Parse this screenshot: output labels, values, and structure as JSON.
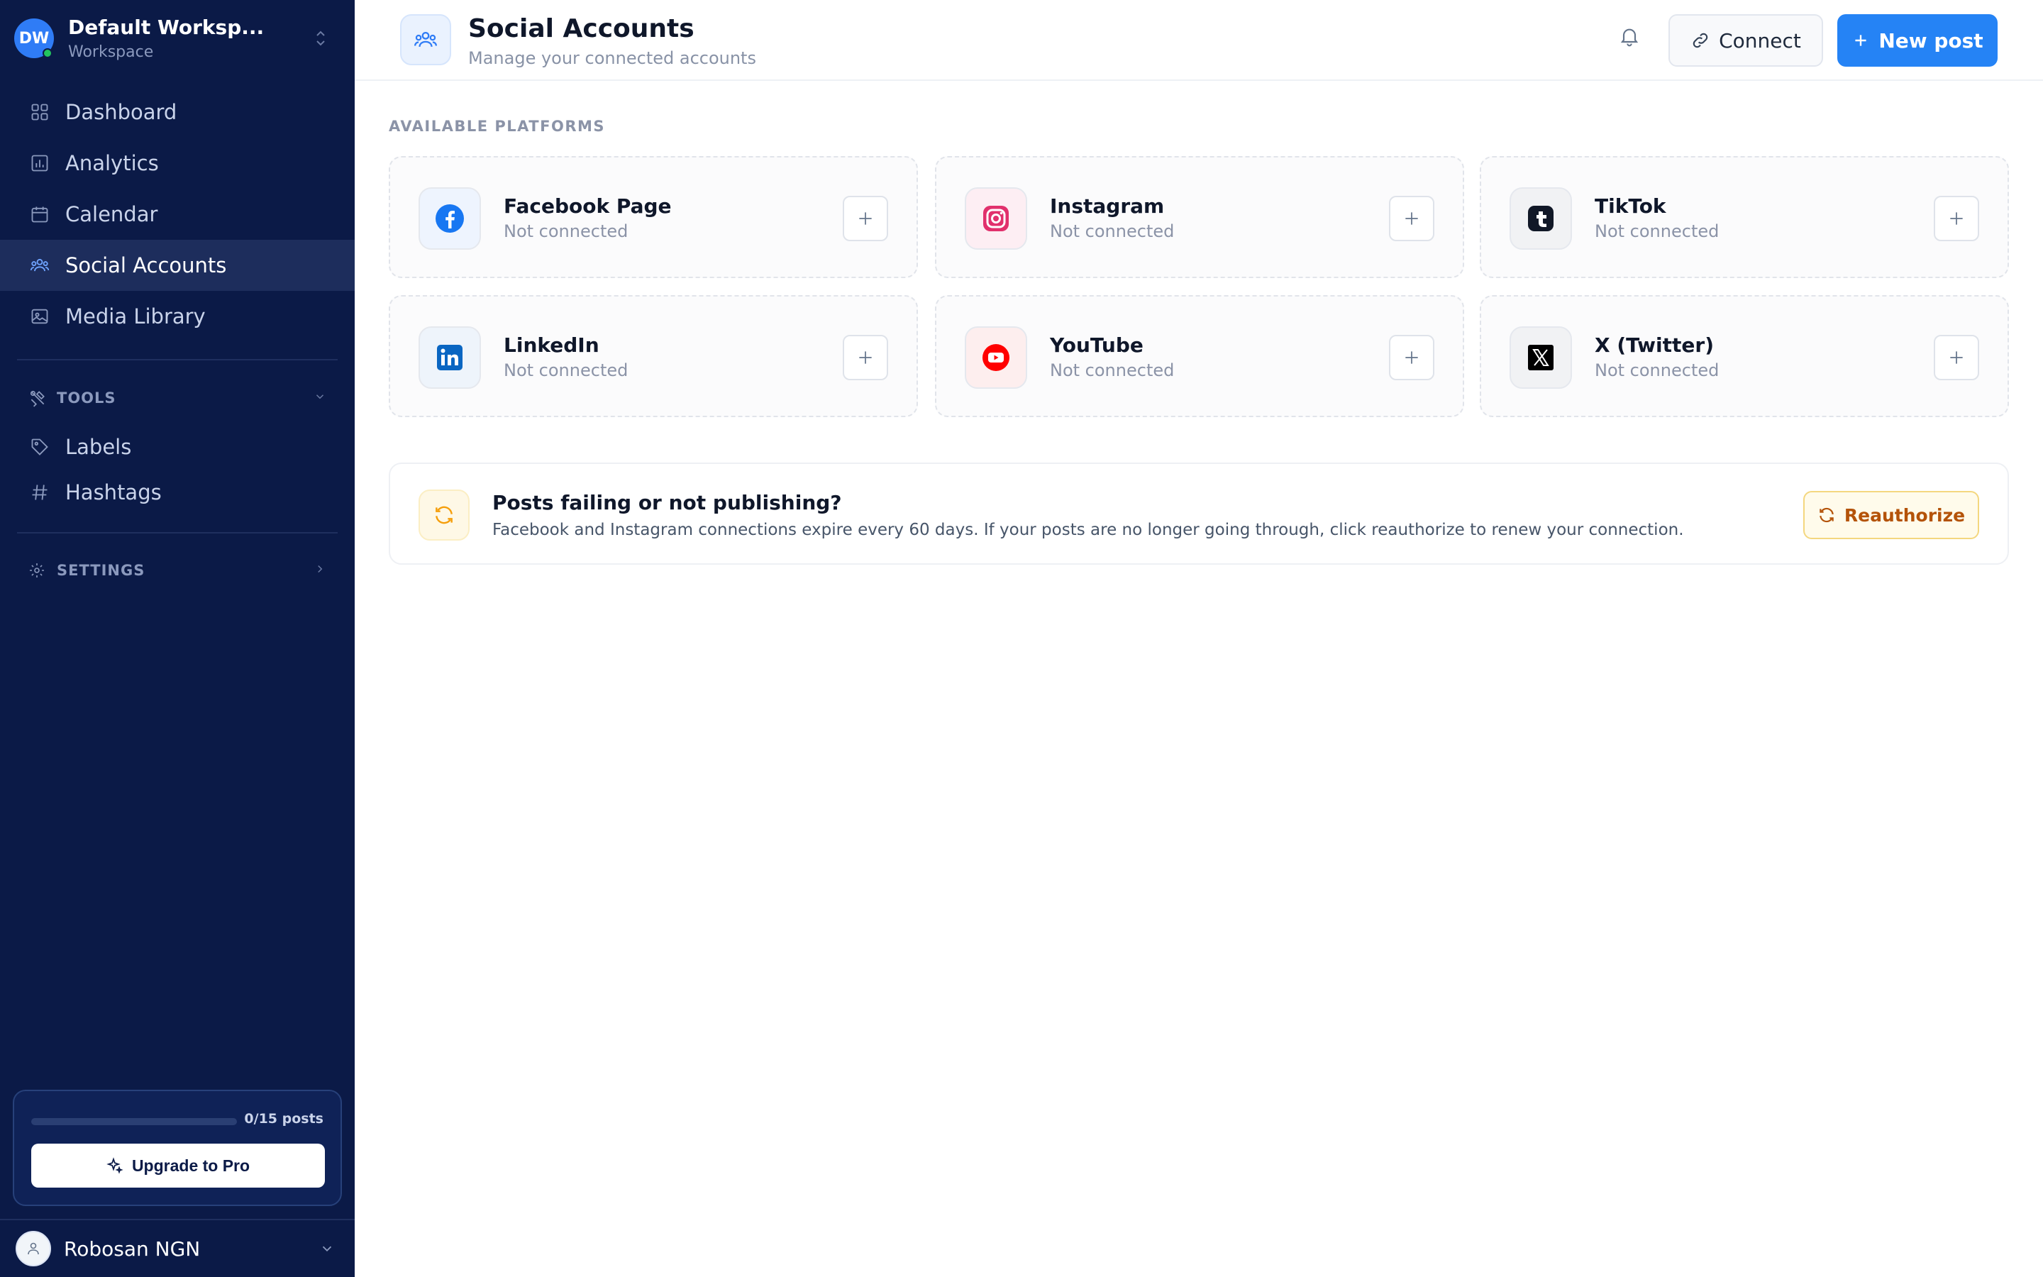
{
  "workspace": {
    "initials": "DW",
    "name": "Default Worksp...",
    "subtitle": "Workspace"
  },
  "nav": [
    {
      "label": "Dashboard",
      "icon": "grid-icon"
    },
    {
      "label": "Analytics",
      "icon": "bar-chart-icon"
    },
    {
      "label": "Calendar",
      "icon": "calendar-icon"
    },
    {
      "label": "Social Accounts",
      "icon": "users-icon",
      "active": true
    },
    {
      "label": "Media Library",
      "icon": "image-icon"
    }
  ],
  "tools": {
    "label": "TOOLS",
    "items": [
      {
        "label": "Labels",
        "icon": "tag-icon"
      },
      {
        "label": "Hashtags",
        "icon": "hash-icon"
      }
    ]
  },
  "settings": {
    "label": "SETTINGS"
  },
  "usage": {
    "count": "0/15 posts",
    "used": 0,
    "limit": 15,
    "upgrade_label": "Upgrade to Pro"
  },
  "user": {
    "name": "Robosan NGN"
  },
  "header": {
    "title": "Social Accounts",
    "subtitle": "Manage your connected accounts",
    "connect_label": "Connect",
    "new_post_label": "New post"
  },
  "platforms_label": "AVAILABLE PLATFORMS",
  "platforms": [
    {
      "name": "Facebook Page",
      "status": "Not connected",
      "icon": "facebook-icon",
      "color": "#1877f2"
    },
    {
      "name": "Instagram",
      "status": "Not connected",
      "icon": "instagram-icon",
      "color": "#e1306c"
    },
    {
      "name": "TikTok",
      "status": "Not connected",
      "icon": "tiktok-icon",
      "color": "#111827"
    },
    {
      "name": "LinkedIn",
      "status": "Not connected",
      "icon": "linkedin-icon",
      "color": "#0a66c2"
    },
    {
      "name": "YouTube",
      "status": "Not connected",
      "icon": "youtube-icon",
      "color": "#ff0000"
    },
    {
      "name": "X (Twitter)",
      "status": "Not connected",
      "icon": "x-twitter-icon",
      "color": "#000000"
    }
  ],
  "alert": {
    "title": "Posts failing or not publishing?",
    "text": "Facebook and Instagram connections expire every 60 days. If your posts are no longer going through, click reauthorize to renew your connection.",
    "button_label": "Reauthorize"
  },
  "colors": {
    "sidebar": "#0b1a47",
    "accent": "#2583f5",
    "warning": "#b45309"
  }
}
